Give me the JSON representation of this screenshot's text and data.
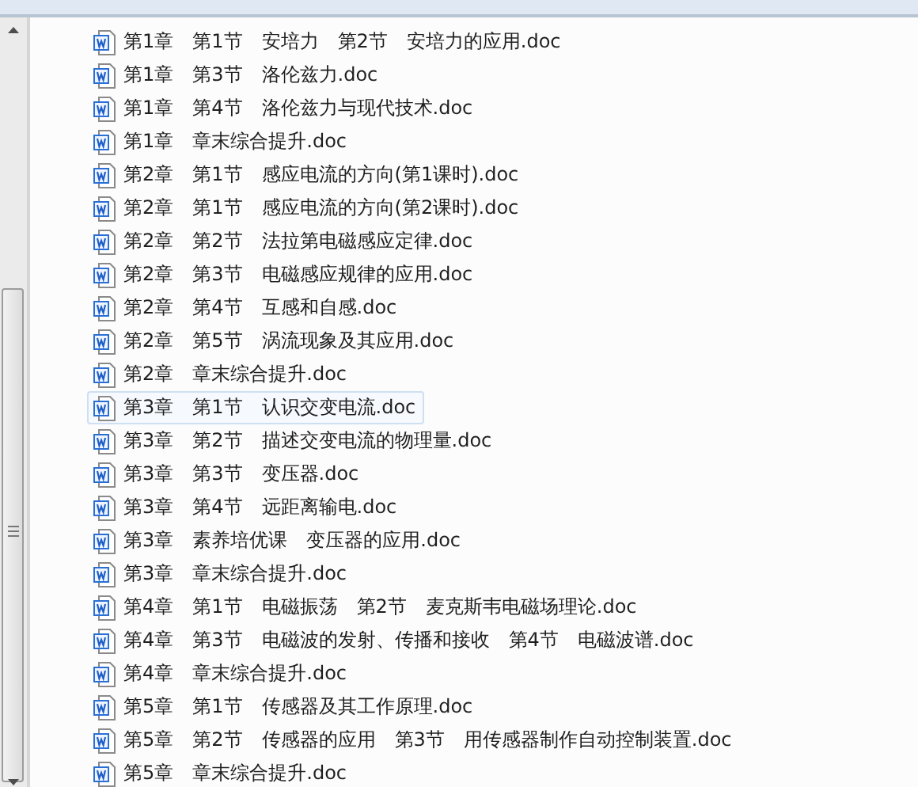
{
  "files": [
    {
      "name": "第1章　第1节　安培力　第2节　安培力的应用.doc",
      "selected": false
    },
    {
      "name": "第1章　第3节　洛伦兹力.doc",
      "selected": false
    },
    {
      "name": "第1章　第4节　洛伦兹力与现代技术.doc",
      "selected": false
    },
    {
      "name": "第1章　章末综合提升.doc",
      "selected": false
    },
    {
      "name": "第2章　第1节　感应电流的方向(第1课时).doc",
      "selected": false
    },
    {
      "name": "第2章　第1节　感应电流的方向(第2课时).doc",
      "selected": false
    },
    {
      "name": "第2章　第2节　法拉第电磁感应定律.doc",
      "selected": false
    },
    {
      "name": "第2章　第3节　电磁感应规律的应用.doc",
      "selected": false
    },
    {
      "name": "第2章　第4节　互感和自感.doc",
      "selected": false
    },
    {
      "name": "第2章　第5节　涡流现象及其应用.doc",
      "selected": false
    },
    {
      "name": "第2章　章末综合提升.doc",
      "selected": false
    },
    {
      "name": "第3章　第1节　认识交变电流.doc",
      "selected": true
    },
    {
      "name": "第3章　第2节　描述交变电流的物理量.doc",
      "selected": false
    },
    {
      "name": "第3章　第3节　变压器.doc",
      "selected": false
    },
    {
      "name": "第3章　第4节　远距离输电.doc",
      "selected": false
    },
    {
      "name": "第3章　素养培优课　变压器的应用.doc",
      "selected": false
    },
    {
      "name": "第3章　章末综合提升.doc",
      "selected": false
    },
    {
      "name": "第4章　第1节　电磁振荡　第2节　麦克斯韦电磁场理论.doc",
      "selected": false
    },
    {
      "name": "第4章　第3节　电磁波的发射、传播和接收　第4节　电磁波谱.doc",
      "selected": false
    },
    {
      "name": "第4章　章末综合提升.doc",
      "selected": false
    },
    {
      "name": "第5章　第1节　传感器及其工作原理.doc",
      "selected": false
    },
    {
      "name": "第5章　第2节　传感器的应用　第3节　用传感器制作自动控制装置.doc",
      "selected": false
    },
    {
      "name": "第5章　章末综合提升.doc",
      "selected": false
    }
  ]
}
